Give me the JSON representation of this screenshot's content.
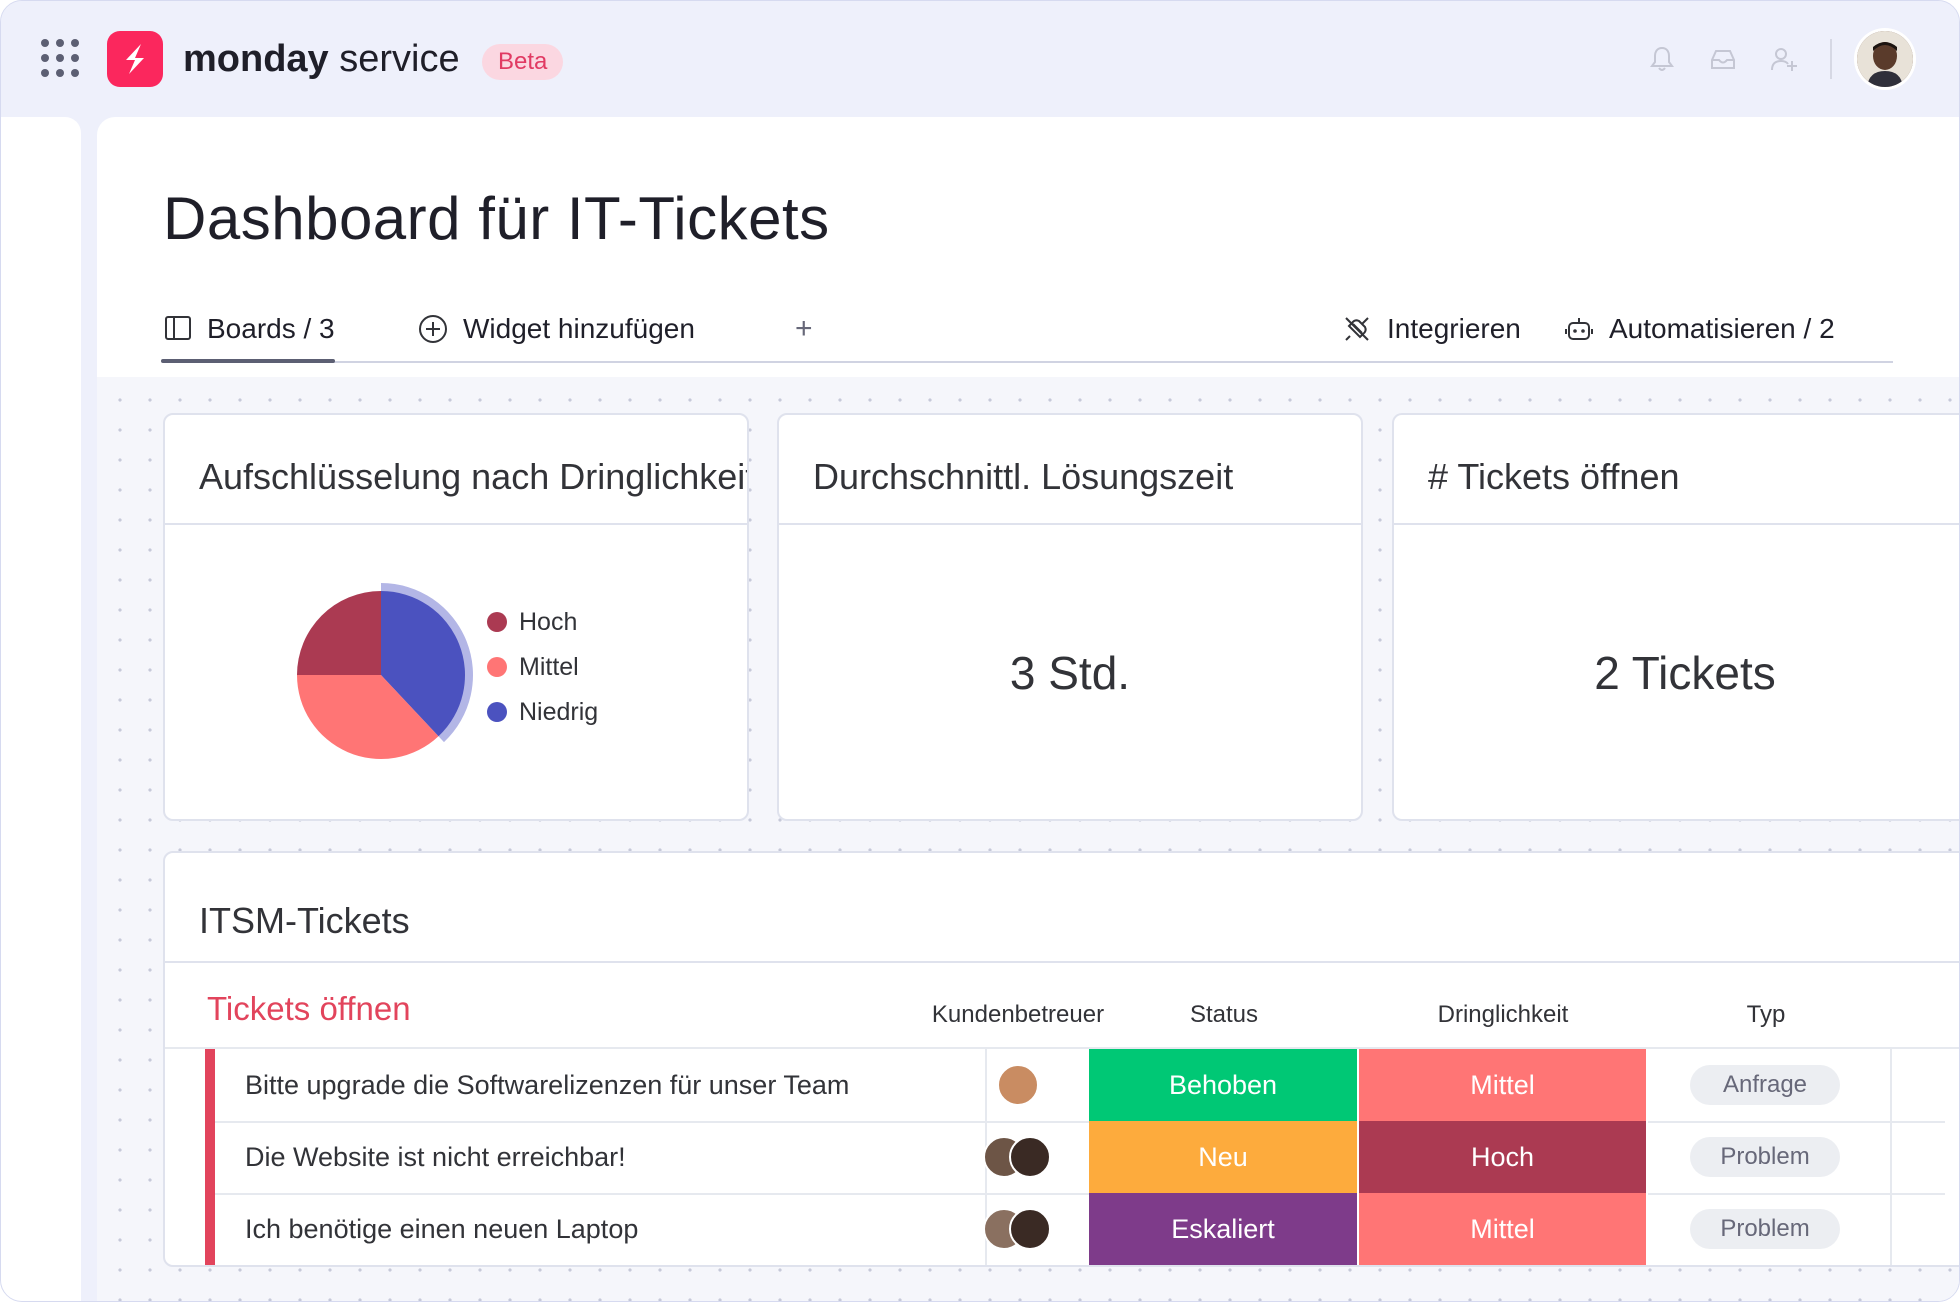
{
  "app": {
    "brand_bold": "monday",
    "brand_light": " service",
    "beta_label": "Beta"
  },
  "page": {
    "title": "Dashboard für IT-Tickets"
  },
  "tabs": {
    "boards": "Boards / 3",
    "add_widget": "Widget hinzufügen",
    "add": "+",
    "integrate": "Integrieren",
    "automate": "Automatisieren / 2"
  },
  "widgets": {
    "urgency": {
      "title": "Aufschlüsselung nach Dringlichkeit",
      "legend": [
        {
          "label": "Hoch",
          "color": "#ab3a52"
        },
        {
          "label": "Mittel",
          "color": "#ff7575"
        },
        {
          "label": "Niedrig",
          "color": "#4b52bf"
        }
      ]
    },
    "resolution": {
      "title": "Durchschnittl. Lösungszeit",
      "value": "3 Std."
    },
    "open_tickets": {
      "title": "# Tickets öffnen",
      "value": "2 Tickets"
    }
  },
  "chart_data": {
    "type": "pie",
    "categories": [
      "Hoch",
      "Mittel",
      "Niedrig"
    ],
    "values": [
      25,
      37,
      38
    ],
    "colors": [
      "#ab3a52",
      "#ff7575",
      "#4b52bf"
    ],
    "highlighted": "Niedrig",
    "legend": "right"
  },
  "table": {
    "title": "ITSM-Tickets",
    "group": "Tickets öffnen",
    "columns": {
      "owner": "Kundenbetreuer",
      "status": "Status",
      "urgency": "Dringlichkeit",
      "type": "Typ",
      "add": "+"
    },
    "rows": [
      {
        "name": "Bitte upgrade die Softwarelizenzen für unser Team",
        "status": "Behoben",
        "status_color": "#00c875",
        "urgency": "Mittel",
        "urgency_color": "#ff7575",
        "type": "Anfrage"
      },
      {
        "name": "Die Website ist nicht erreichbar!",
        "status": "Neu",
        "status_color": "#fdab3d",
        "urgency": "Hoch",
        "urgency_color": "#ab3a52",
        "type": "Problem"
      },
      {
        "name": "Ich benötige einen neuen Laptop",
        "status": "Eskaliert",
        "status_color": "#7e3b8a",
        "urgency": "Mittel",
        "urgency_color": "#ff7575",
        "type": "Problem"
      }
    ]
  }
}
